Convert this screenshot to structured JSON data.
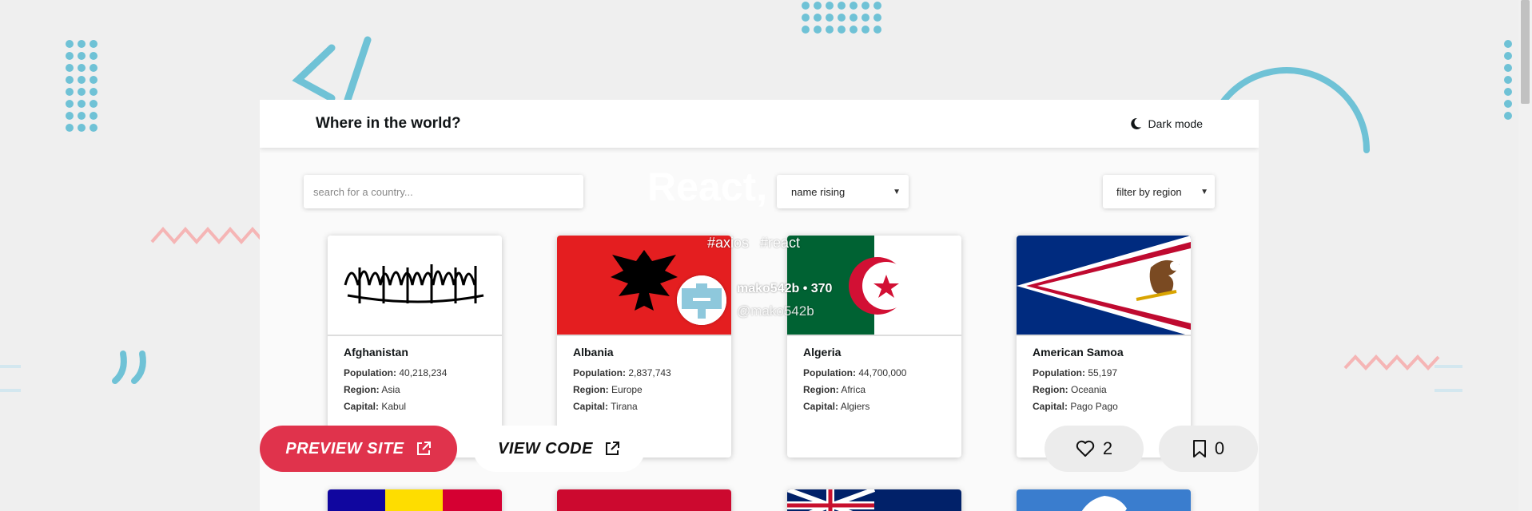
{
  "header": {
    "title": "Where in the world?",
    "dark_mode_label": "Dark mode"
  },
  "controls": {
    "search_placeholder": "search for a country...",
    "sort_value": "name rising",
    "region_value": "filter by region"
  },
  "countries": [
    {
      "name": "Afghanistan",
      "population": "40,218,234",
      "region": "Asia",
      "capital": "Kabul"
    },
    {
      "name": "Albania",
      "population": "2,837,743",
      "region": "Europe",
      "capital": "Tirana"
    },
    {
      "name": "Algeria",
      "population": "44,700,000",
      "region": "Africa",
      "capital": "Algiers"
    },
    {
      "name": "American Samoa",
      "population": "55,197",
      "region": "Oceania",
      "capital": "Pago Pago"
    }
  ],
  "labels": {
    "population": "Population:",
    "region": "Region:",
    "capital": "Capital:"
  },
  "overlay": {
    "title": "React,",
    "tags": [
      "#axios",
      "#react"
    ],
    "author": "mako542b • 370",
    "handle": "@mako542b"
  },
  "actions": {
    "preview_label": "PREVIEW SITE",
    "code_label": "VIEW CODE",
    "likes": "2",
    "bookmarks": "0"
  },
  "colors": {
    "accent": "#e0334c",
    "decor": "#6fc2d6",
    "decor_pink": "#f5b5b5"
  }
}
